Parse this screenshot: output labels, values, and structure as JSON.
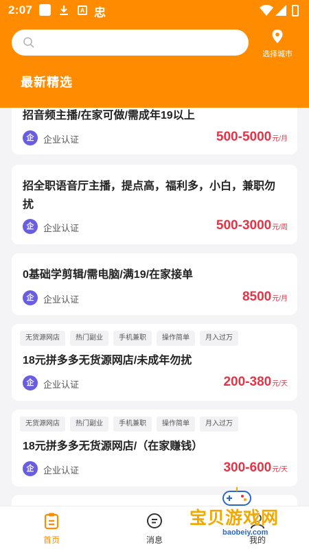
{
  "status_bar": {
    "time": "2:07",
    "icons": [
      "app-square-icon",
      "download-icon",
      "a-box-icon",
      "chinese-glyph-icon",
      "wifi-icon",
      "signal-icon",
      "battery-icon"
    ],
    "glyph": "忠",
    "a_label": "A"
  },
  "header": {
    "search": {
      "placeholder": ""
    },
    "city_label": "选择城市",
    "section_title": "最新精选",
    "accent": "#ff8c00"
  },
  "cards": [
    {
      "title": "招音频主播/在家可做/需成年19以上",
      "tags": [],
      "cert": "企业认证",
      "cert_icon": "企",
      "salary": "500-5000",
      "unit": "元/月"
    },
    {
      "title": "招全职语音厅主播，提点高，福利多，小白，兼职勿扰",
      "tags": [],
      "cert": "企业认证",
      "cert_icon": "企",
      "salary": "500-3000",
      "unit": "元/周"
    },
    {
      "title": "0基础学剪辑/需电脑/满19/在家接单",
      "tags": [],
      "cert": "企业认证",
      "cert_icon": "企",
      "salary": "8500",
      "unit": "元/月"
    },
    {
      "title": "18元拼多多无货源网店/未成年勿扰",
      "tags": [
        "无货源网店",
        "热门副业",
        "手机兼职",
        "操作简单",
        "月入过万"
      ],
      "cert": "企业认证",
      "cert_icon": "企",
      "salary": "200-380",
      "unit": "元/天"
    },
    {
      "title": "18元拼多多无货源网店/（在家赚钱）",
      "tags": [
        "无货源网店",
        "热门副业",
        "手机兼职",
        "操作简单",
        "月入过万"
      ],
      "cert": "企业认证",
      "cert_icon": "企",
      "salary": "300-600",
      "unit": "元/天"
    }
  ],
  "bottom_nav": [
    {
      "label": "首页",
      "icon": "home-clipboard-icon",
      "active": true
    },
    {
      "label": "消息",
      "icon": "message-icon",
      "active": false
    },
    {
      "label": "我的",
      "icon": "profile-icon",
      "active": false
    }
  ],
  "watermark": {
    "text": "宝贝游戏网",
    "url": "baobeiy.com"
  },
  "colors": {
    "salary": "#e53345",
    "cert_badge": "#6a5ee0",
    "background": "#f4f4f6"
  }
}
